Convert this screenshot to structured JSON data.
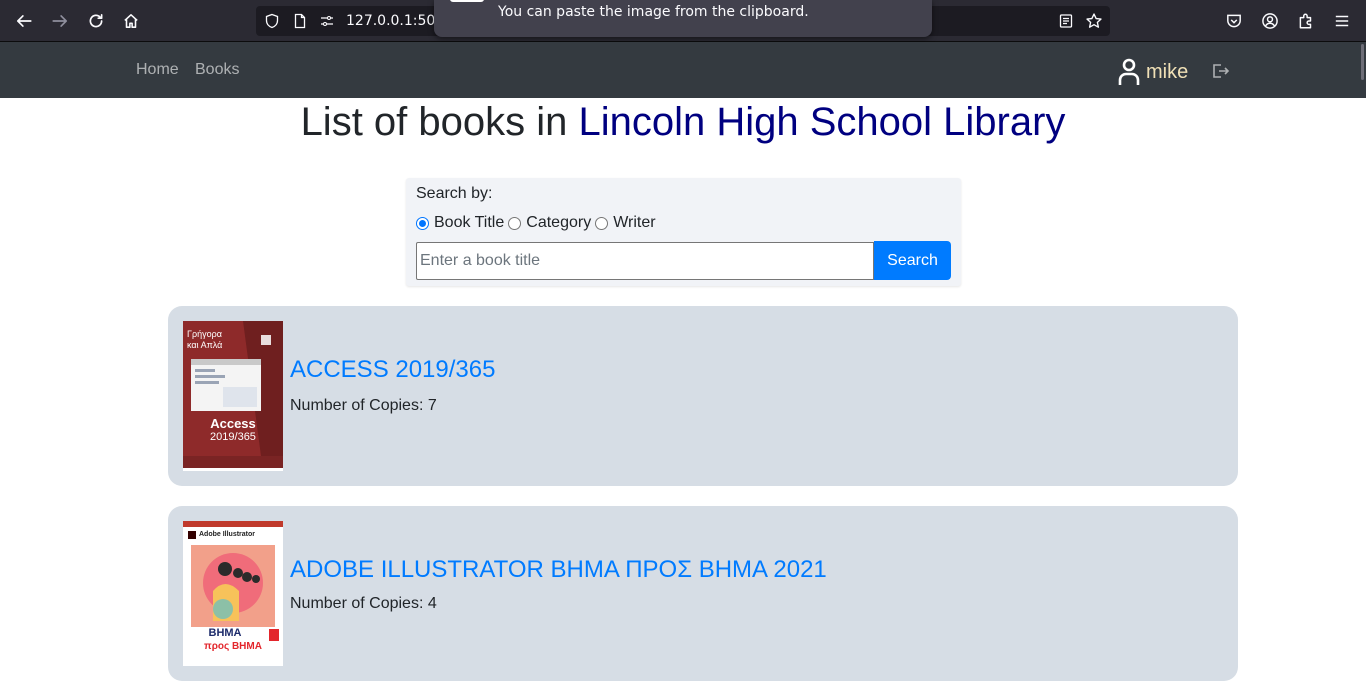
{
  "browser": {
    "url": "127.0.0.1:500",
    "popup_text": "You can paste the image from the clipboard."
  },
  "navbar": {
    "home": "Home",
    "books": "Books",
    "user": "mike"
  },
  "page": {
    "title_prefix": "List of books in ",
    "library_name": "Lincoln High School Library"
  },
  "search": {
    "label": "Search by:",
    "options": [
      "Book Title",
      "Category",
      "Writer"
    ],
    "selected": "Book Title",
    "placeholder": "Enter a book title",
    "button": "Search"
  },
  "books": [
    {
      "title": "ACCESS 2019/365",
      "copies": "Number of Copies: 7",
      "cover": {
        "top": "Γρήγορα και Απλά",
        "name": "Access",
        "version": "2019/365"
      }
    },
    {
      "title": "ADOBE ILLUSTRATOR ΒΗΜΑ ΠΡΟΣ ΒΗΜΑ 2021",
      "copies": "Number of Copies: 4",
      "cover": {
        "top": "Adobe Illustrator",
        "name": "ΒΗΜΑ",
        "version": "προς ΒΗΜΑ"
      }
    }
  ]
}
